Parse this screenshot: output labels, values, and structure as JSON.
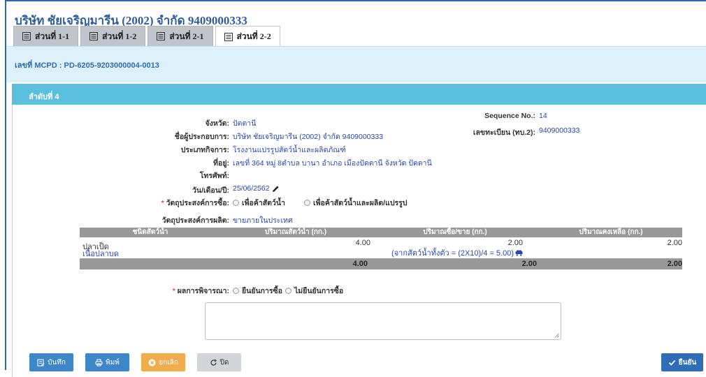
{
  "company": {
    "title": "บริษัท ชัยเจริญมารีน (2002) จำกัด 9409000333"
  },
  "tabs": [
    {
      "label": "ส่วนที่ 1-1",
      "icon": "list-icon"
    },
    {
      "label": "ส่วนที่ 1-2",
      "icon": "list-icon"
    },
    {
      "label": "ส่วนที่ 2-1",
      "icon": "list-icon"
    },
    {
      "label": "ส่วนที่ 2-2",
      "icon": "list-icon",
      "active": true
    }
  ],
  "header": {
    "mcpd": "เลขที่ MCPD : PD-6205-9203000004-0013"
  },
  "panel": {
    "title": "ลำดับที่ 4"
  },
  "info": {
    "province_label": "จังหวัด:",
    "province_value": "ปัตตานี",
    "operator_label": "ชื่อผู้ประกอบการ:",
    "operator_value": "บริษัท ชัยเจริญมารีน (2002) จำกัด 9409000333",
    "business_label": "ประเภทกิจการ:",
    "business_value": "โรงงานแปรรูปสัตว์น้ำและผลิตภัณฑ์",
    "address_label": "ที่อยู่:",
    "address_value": "เลขที่ 364 หมู่ 8ตำบล บานา อำเภอ เมืองปัตตานี จังหวัด ปัตตานี",
    "phone_label": "โทรศัพท์:",
    "phone_value": "",
    "sequence_label": "Sequence No.:",
    "sequence_value": "14",
    "registration_label": "เลขทะเบียน (ทบ.2):",
    "registration_value": "9409000333",
    "date_label": "วัน/เดือน/ปี:",
    "date_value": "25/06/2562",
    "purchase_purpose_label": "วัตถุประสงค์การซื้อ:",
    "purchase_purpose_options": [
      "เพื่อค้าสัตว์น้ำ",
      "เพื่อค้าสัตว์น้ำและผลิต/แปรรูป"
    ],
    "production_purpose_label": "วัตถุประสงค์การผลิต:",
    "production_purpose_value": "ขายภายในประเทศ"
  },
  "table": {
    "headers": [
      "ชนิดสัตว์น้ำ",
      "ปริมาณสัตว์น้ำ (กก.)",
      "ปริมาณซื้อ/ขาย (กก.)",
      "ปริมาณคงเหลือ (กก.)"
    ],
    "rows": [
      {
        "species": "ปลาเป็ด",
        "species_sub": "เนื้อปลาบด",
        "quantity": "4.00",
        "purchase": "2.00",
        "purchase_note": "(จากสัตว์น้ำทั้งตัว = (2X10)/4 = 5.00)",
        "remaining": "2.00"
      }
    ],
    "totals": {
      "quantity": "4.00",
      "purchase": "2.00",
      "remaining": "2.00"
    }
  },
  "consideration": {
    "label": "ผลการพิจารณา:",
    "options": [
      "ยืนยันการซื้อ",
      "ไม่ยืนยันการซื้อ"
    ]
  },
  "buttons": {
    "save": "บันทึก",
    "print": "พิมพ์",
    "cancel": "ยกเลิก",
    "close": "ปิด",
    "confirm": "ยืนยัน"
  },
  "colors": {
    "accent": "#5bc0de",
    "title": "#2e5e9e",
    "link": "#2747b2",
    "required": "#d9534f",
    "button_primary": "#3e86c8",
    "button_warning": "#f0ad4e"
  }
}
